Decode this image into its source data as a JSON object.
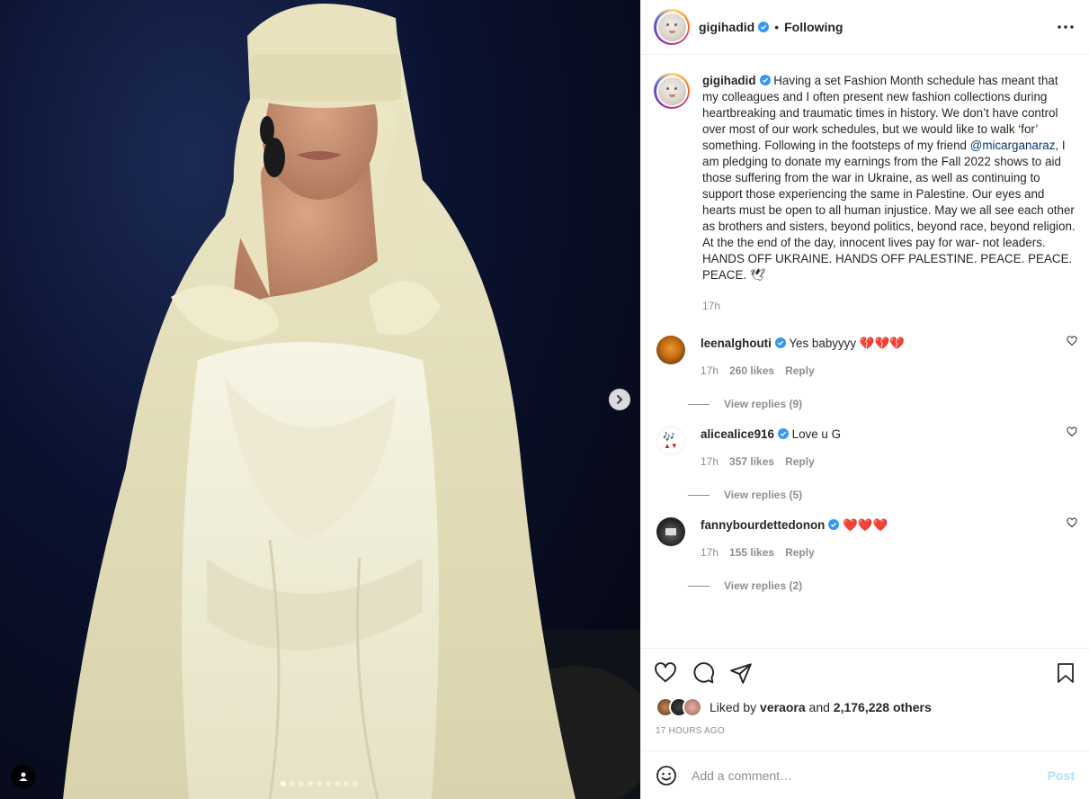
{
  "post": {
    "username": "gigihadid",
    "follow_state": "Following",
    "caption": {
      "username": "gigihadid",
      "text_before_mention": "Having a set Fashion Month schedule has meant that my colleagues and I often present new fashion collections during heartbreaking and traumatic times in history. We don’t have control over most of our work schedules, but we would like to walk ‘for’ something. Following in the footsteps of my friend",
      "mention": "@micarganaraz,",
      "text_after_mention": "I am pledging to donate my earnings from the Fall 2022 shows to aid those suffering from the war in Ukraine, as well as continuing to support those experiencing the same in Palestine. Our eyes and hearts must be open to all human injustice. May we all see each other as brothers and sisters, beyond politics, beyond race, beyond religion. At the the end of the day, innocent lives pay for war- not leaders.",
      "text_final": "HANDS OFF UKRAINE. HANDS OFF PALESTINE. PEACE. PEACE. PEACE. 🕊",
      "time": "17h"
    },
    "comments": [
      {
        "username": "leenalghouti",
        "text": "Yes babyyyy",
        "emoji": "💔💔💔",
        "time": "17h",
        "likes": "260 likes",
        "reply": "Reply",
        "view_replies": "View replies (9)"
      },
      {
        "username": "alicealice916",
        "text": "Love u G",
        "time": "17h",
        "likes": "357 likes",
        "reply": "Reply",
        "view_replies": "View replies (5)"
      },
      {
        "username": "fannybourdettedonon",
        "text": "",
        "emoji": "❤️❤️❤️",
        "time": "17h",
        "likes": "155 likes",
        "reply": "Reply",
        "view_replies": "View replies (2)"
      }
    ],
    "liked_by": {
      "prefix": "Liked by",
      "user": "veraora",
      "and_text": "and",
      "others": "2,176,228 others"
    },
    "timestamp": "17 HOURS AGO",
    "add_comment": {
      "placeholder": "Add a comment…",
      "post_label": "Post"
    }
  },
  "media": {
    "carousel_count": 9,
    "active_index": 0
  },
  "colors": {
    "verified": "#3897f0",
    "link": "#00376b",
    "muted": "#8e8e8e",
    "post_button": "#b2dffc"
  },
  "icons": [
    "more-options-icon",
    "verified-icon",
    "heart-icon",
    "comment-icon",
    "share-icon",
    "bookmark-icon",
    "emoji-icon",
    "chevron-right-icon",
    "user-tag-icon"
  ]
}
